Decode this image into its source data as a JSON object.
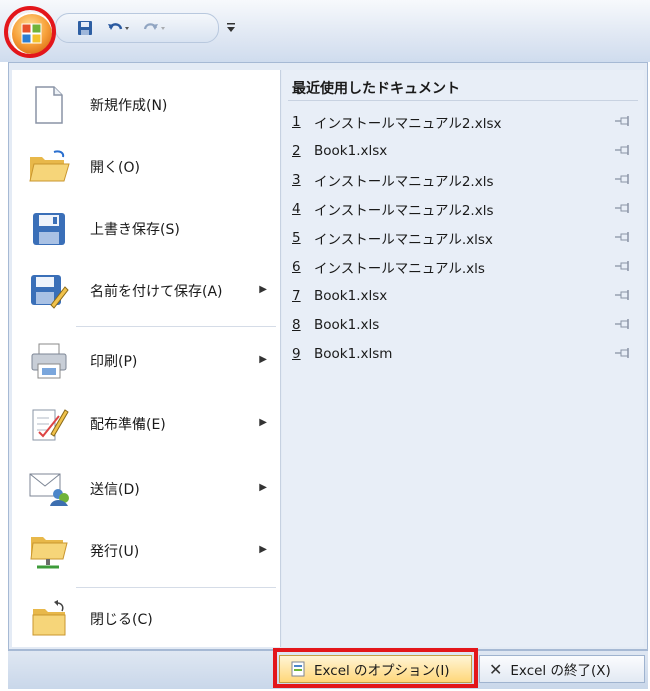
{
  "commands": [
    {
      "label": "新規作成(N)",
      "icon": "new-document-icon",
      "submenu": false
    },
    {
      "label": "開く(O)",
      "icon": "open-folder-icon",
      "submenu": false
    },
    {
      "label": "上書き保存(S)",
      "icon": "save-disk-icon",
      "submenu": false
    },
    {
      "label": "名前を付けて保存(A)",
      "icon": "save-as-icon",
      "submenu": true
    },
    {
      "label": "印刷(P)",
      "icon": "printer-icon",
      "submenu": true
    },
    {
      "label": "配布準備(E)",
      "icon": "prepare-document-icon",
      "submenu": true
    },
    {
      "label": "送信(D)",
      "icon": "send-icon",
      "submenu": true
    },
    {
      "label": "発行(U)",
      "icon": "publish-icon",
      "submenu": true
    },
    {
      "label": "閉じる(C)",
      "icon": "close-folder-icon",
      "submenu": false
    }
  ],
  "recent": {
    "title": "最近使用したドキュメント",
    "items": [
      {
        "num": "1",
        "name": "インストールマニュアル2.xlsx"
      },
      {
        "num": "2",
        "name": "Book1.xlsx"
      },
      {
        "num": "3",
        "name": "インストールマニュアル2.xls"
      },
      {
        "num": "4",
        "name": "インストールマニュアル2.xls"
      },
      {
        "num": "5",
        "name": "インストールマニュアル.xlsx"
      },
      {
        "num": "6",
        "name": "インストールマニュアル.xls"
      },
      {
        "num": "7",
        "name": "Book1.xlsx"
      },
      {
        "num": "8",
        "name": "Book1.xls"
      },
      {
        "num": "9",
        "name": "Book1.xlsm"
      }
    ]
  },
  "footer": {
    "options_label": "Excel のオプション(I)",
    "exit_label": "Excel の終了(X)"
  },
  "colors": {
    "highlight": "#e3161b",
    "menu_bg": "#e4ebf5"
  }
}
